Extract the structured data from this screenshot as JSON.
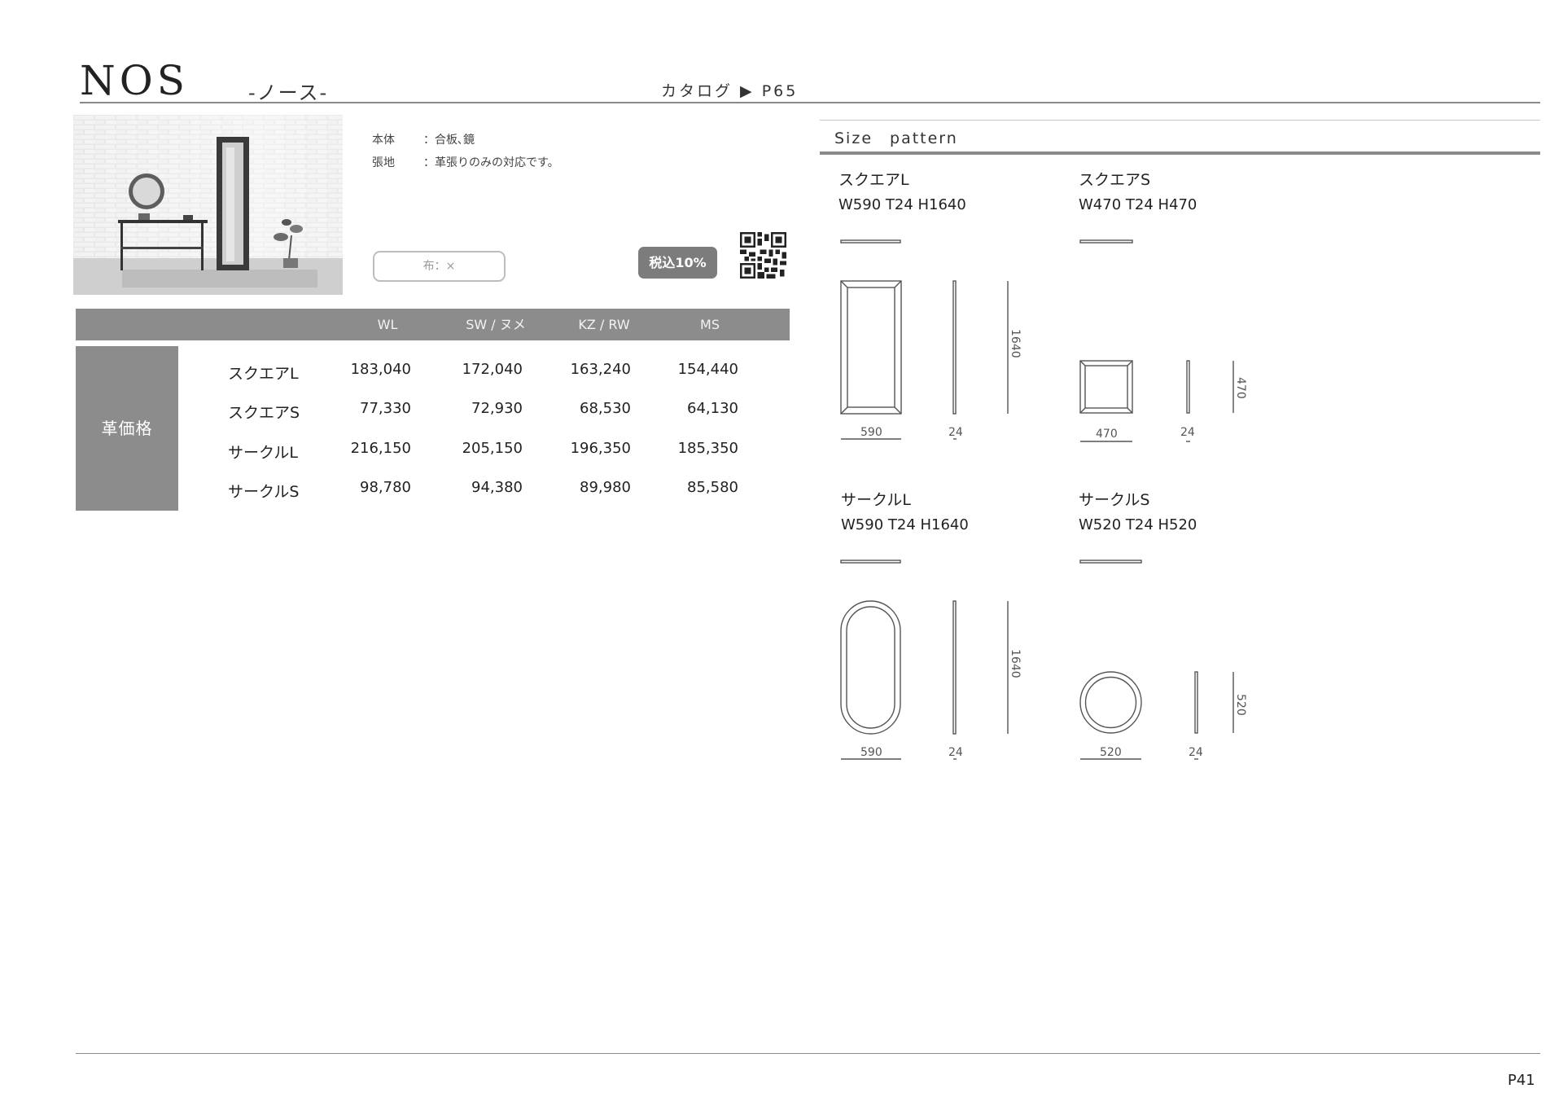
{
  "header": {
    "title": "NOS",
    "kana": "-ノース-",
    "catalog_ref": "カタログ ▶ P65"
  },
  "spec": {
    "rows": [
      {
        "label": "本体",
        "value": "：合板､鏡"
      },
      {
        "label": "張地",
        "value": "：革張りのみの対応です。"
      }
    ],
    "fabric_button": "布：×",
    "tax_badge": "税込10%"
  },
  "price_table": {
    "columns": [
      "WL",
      "SW / ヌメ",
      "KZ / RW",
      "MS"
    ],
    "group_label": "革価格",
    "rows": [
      {
        "name": "スクエアL",
        "values": [
          "183,040",
          "172,040",
          "163,240",
          "154,440"
        ]
      },
      {
        "name": "スクエアS",
        "values": [
          "77,330",
          "72,930",
          "68,530",
          "64,130"
        ]
      },
      {
        "name": "サークルL",
        "values": [
          "216,150",
          "205,150",
          "196,350",
          "185,350"
        ]
      },
      {
        "name": "サークルS",
        "values": [
          "98,780",
          "94,380",
          "89,980",
          "85,580"
        ]
      }
    ]
  },
  "size_pattern": {
    "heading": "Size　pattern",
    "items": [
      {
        "name": "スクエアL",
        "dims": "W590 T24 H1640",
        "w": "590",
        "t": "24",
        "h": "1640"
      },
      {
        "name": "スクエアS",
        "dims": "W470 T24 H470",
        "w": "470",
        "t": "24",
        "h": "470"
      },
      {
        "name": "サークルL",
        "dims": "W590 T24 H1640",
        "w": "590",
        "t": "24",
        "h": "1640"
      },
      {
        "name": "サークルS",
        "dims": "W520 T24 H520",
        "w": "520",
        "t": "24",
        "h": "520"
      }
    ]
  },
  "footer": {
    "page": "P41"
  }
}
